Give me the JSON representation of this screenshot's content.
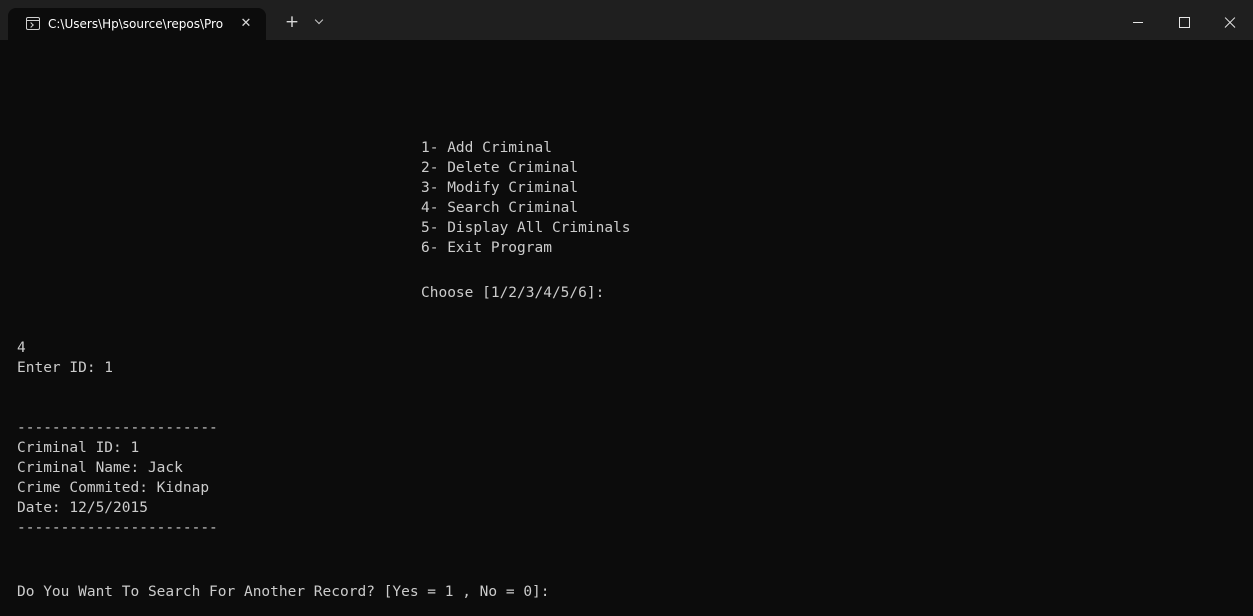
{
  "tab": {
    "title": "C:\\Users\\Hp\\source\\repos\\Pro",
    "close_glyph": "✕",
    "new_tab_glyph": "+",
    "dropdown_icon": "chevron-down-icon"
  },
  "window_controls": [
    "minimize-icon",
    "maximize-icon",
    "close-icon"
  ],
  "colors": {
    "terminal_background": "#0c0c0c",
    "titlebar_background": "#1f1f1f",
    "text": "#cccccc"
  },
  "console": {
    "menu": [
      "1- Add Criminal",
      "2- Delete Criminal",
      "3- Modify Criminal",
      "4- Search Criminal",
      "5- Display All Criminals",
      "6- Exit Program"
    ],
    "prompt": "Choose [1/2/3/4/5/6]:",
    "user_choice": "4",
    "enter_id": "Enter ID: 1",
    "separator": "-----------------------",
    "record": [
      "Criminal ID: 1",
      "Criminal Name: Jack",
      "Crime Commited: Kidnap",
      "Date: 12/5/2015"
    ],
    "separator_end": "-----------------------",
    "again_prompt": "Do You Want To Search For Another Record? [Yes = 1 , No = 0]:"
  }
}
